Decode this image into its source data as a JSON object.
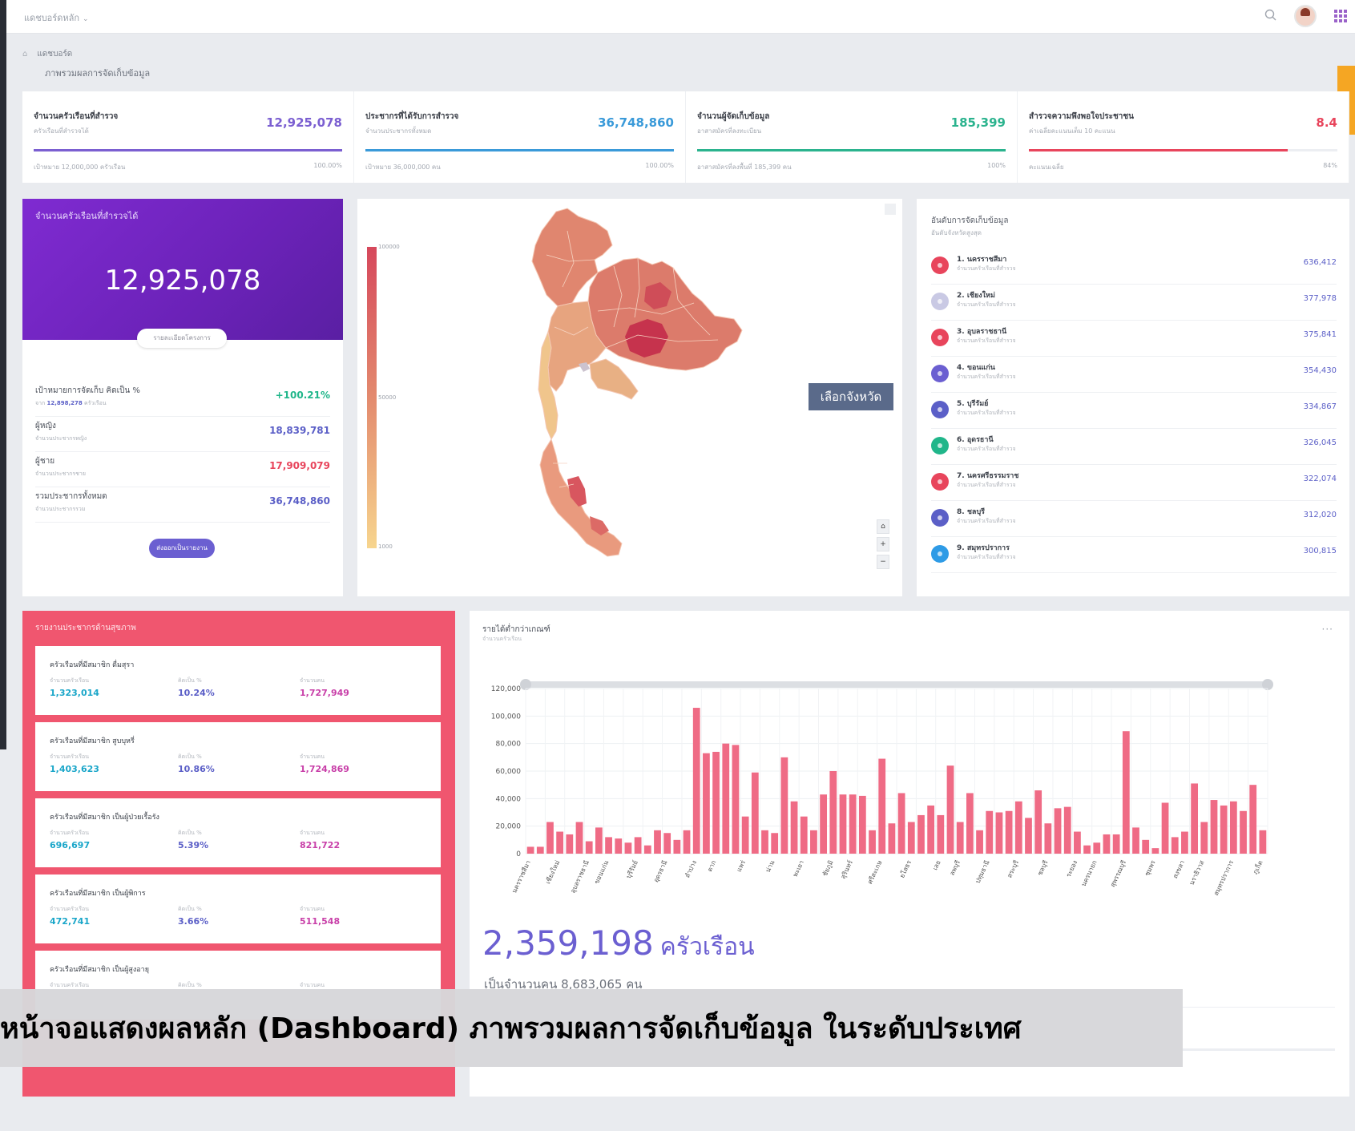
{
  "topbar": {
    "brand": "แดชบอร์ดหลัก"
  },
  "breadcrumb": {
    "label": "แดชบอร์ด"
  },
  "page_title": "ภาพรวมผลการจัดเก็บข้อมูล",
  "kpis": [
    {
      "title": "จำนวนครัวเรือนที่สำรวจ",
      "sub": "ครัวเรือนที่สำรวจได้",
      "value": "12,925,078",
      "progress": 1.0,
      "foot_left": "เป้าหมาย 12,000,000 ครัวเรือน",
      "foot_right": "100.00%",
      "color": "#7b5fd1"
    },
    {
      "title": "ประชากรที่ได้รับการสำรวจ",
      "sub": "จำนวนประชากรทั้งหมด",
      "value": "36,748,860",
      "progress": 1.0,
      "foot_left": "เป้าหมาย 36,000,000 คน",
      "foot_right": "100.00%",
      "color": "#3a9ad9"
    },
    {
      "title": "จำนวนผู้จัดเก็บข้อมูล",
      "sub": "อาสาสมัครที่ลงทะเบียน",
      "value": "185,399",
      "progress": 1.0,
      "foot_left": "อาสาสมัครที่ลงพื้นที่ 185,399 คน",
      "foot_right": "100%",
      "color": "#2bb38e"
    },
    {
      "title": "สำรวจความพึงพอใจประชาชน",
      "sub": "ค่าเฉลี่ยคะแนนเต็ม 10 คะแนน",
      "value": "8.4",
      "progress": 0.84,
      "foot_left": "คะแนนเฉลี่ย",
      "foot_right": "84%",
      "color": "#e8455c"
    }
  ],
  "household_card": {
    "label": "จำนวนครัวเรือนที่สำรวจได้",
    "total": "12,925,078",
    "detail_button": "รายละเอียดโครงการ",
    "stats": [
      {
        "name": "เป้าหมายการจัดเก็บ คิดเป็น %",
        "sub_prefix": "จาก",
        "sub_value": "12,898,278",
        "sub_suffix": "ครัวเรือน",
        "value": "+100.21%",
        "color": "#20b68a"
      },
      {
        "name": "ผู้หญิง",
        "sub_prefix": "จำนวนประชากรหญิง",
        "value": "18,839,781",
        "color": "#5b5fc7"
      },
      {
        "name": "ผู้ชาย",
        "sub_prefix": "จำนวนประชากรชาย",
        "value": "17,909,079",
        "color": "#e8455c"
      },
      {
        "name": "รวมประชากรทั้งหมด",
        "sub_prefix": "จำนวนประชากรรวม",
        "value": "36,748,860",
        "color": "#5b5fc7"
      }
    ],
    "admin_button": "ส่งออกเป็นรายงาน"
  },
  "map": {
    "legend_high": "100000",
    "legend_mid": "50000",
    "legend_low": "1000",
    "province_button": "เลือกจังหวัด",
    "zoom_home": "⌂",
    "zoom_in": "+",
    "zoom_out": "−"
  },
  "ranking": {
    "title": "อันดับการจัดเก็บข้อมูล",
    "subtitle": "อันดับจังหวัดสูงสุด",
    "items": [
      {
        "name": "1. นครราชสีมา",
        "sub": "จำนวนครัวเรือนที่สำรวจ",
        "value": "636,412",
        "color": "#e8455c"
      },
      {
        "name": "2. เชียงใหม่",
        "sub": "จำนวนครัวเรือนที่สำรวจ",
        "value": "377,978",
        "color": "#c9c9e4"
      },
      {
        "name": "3. อุบลราชธานี",
        "sub": "จำนวนครัวเรือนที่สำรวจ",
        "value": "375,841",
        "color": "#e8455c"
      },
      {
        "name": "4. ขอนแก่น",
        "sub": "จำนวนครัวเรือนที่สำรวจ",
        "value": "354,430",
        "color": "#6b5fd1"
      },
      {
        "name": "5. บุรีรัมย์",
        "sub": "จำนวนครัวเรือนที่สำรวจ",
        "value": "334,867",
        "color": "#5b5fc7"
      },
      {
        "name": "6. อุดรธานี",
        "sub": "จำนวนครัวเรือนที่สำรวจ",
        "value": "326,045",
        "color": "#20b68a"
      },
      {
        "name": "7. นครศรีธรรมราช",
        "sub": "จำนวนครัวเรือนที่สำรวจ",
        "value": "322,074",
        "color": "#e8455c"
      },
      {
        "name": "8. ชลบุรี",
        "sub": "จำนวนครัวเรือนที่สำรวจ",
        "value": "312,020",
        "color": "#5b5fc7"
      },
      {
        "name": "9. สมุทรปราการ",
        "sub": "จำนวนครัวเรือนที่สำรวจ",
        "value": "300,815",
        "color": "#2e9be6"
      }
    ]
  },
  "health": {
    "title": "รายงานประชากรด้านสุขภาพ",
    "col1_label": "จำนวนครัวเรือน",
    "col2_label": "คิดเป็น %",
    "col3_label": "จำนวนคน",
    "items": [
      {
        "title": "ครัวเรือนที่มีสมาชิก ดื่มสุรา",
        "households": "1,323,014",
        "percent": "10.24%",
        "people": "1,727,949"
      },
      {
        "title": "ครัวเรือนที่มีสมาชิก สูบบุหรี่",
        "households": "1,403,623",
        "percent": "10.86%",
        "people": "1,724,869"
      },
      {
        "title": "ครัวเรือนที่มีสมาชิก เป็นผู้ป่วยเรื้อรัง",
        "households": "696,697",
        "percent": "5.39%",
        "people": "821,722"
      },
      {
        "title": "ครัวเรือนที่มีสมาชิก เป็นผู้พิการ",
        "households": "472,741",
        "percent": "3.66%",
        "people": "511,548"
      },
      {
        "title": "ครัวเรือนที่มีสมาชิก เป็นผู้สูงอายุ",
        "households": "",
        "percent": "",
        "people": ""
      }
    ]
  },
  "chart_card": {
    "title": "รายได้ต่ำกว่าเกณฑ์",
    "subtitle": "จำนวนครัวเรือน",
    "menu": "···",
    "total_value": "2,359,198",
    "total_unit": "ครัวเรือน",
    "people_text": "เป็นจำนวนคน 8,683,065 คน"
  },
  "chart_data": {
    "type": "bar",
    "ylim": [
      0,
      120000
    ],
    "yticks": [
      0,
      20000,
      40000,
      60000,
      80000,
      100000,
      120000
    ],
    "ytick_labels": [
      "0",
      "20,000",
      "40,000",
      "60,000",
      "80,000",
      "100,000",
      "120,000"
    ],
    "grid": true,
    "color": "#ef6b85",
    "values": [
      5000,
      5000,
      23000,
      16000,
      14000,
      23000,
      9000,
      19000,
      12000,
      11000,
      8000,
      12000,
      6000,
      17000,
      15000,
      10000,
      17000,
      106000,
      73000,
      74000,
      80000,
      79000,
      27000,
      59000,
      17000,
      15000,
      70000,
      38000,
      27000,
      17000,
      43000,
      60000,
      43000,
      43000,
      42000,
      17000,
      69000,
      22000,
      44000,
      23000,
      28000,
      35000,
      28000,
      64000,
      23000,
      44000,
      17000,
      31000,
      30000,
      31000,
      38000,
      26000,
      46000,
      22000,
      33000,
      34000,
      16000,
      6000,
      8000,
      14000,
      14000,
      89000,
      19000,
      10000,
      4000,
      37000,
      12000,
      16000,
      51000,
      23000,
      39000,
      35000,
      38000,
      31000,
      50000,
      17000
    ],
    "category_labels": [
      "นครราชสีมา",
      "เชียงใหม่",
      "อุบลราชธานี",
      "ขอนแก่น",
      "บุรีรัมย์",
      "อุดรธานี",
      "ลำปาง",
      "ตาก",
      "แพร่",
      "น่าน",
      "พะเยา",
      "ชัยภูมิ",
      "สุรินทร์",
      "ศรีสะเกษ",
      "ยโสธร",
      "เลย",
      "ลพบุรี",
      "ปทุมธานี",
      "สระบุรี",
      "ชลบุรี",
      "ระยอง",
      "นครนายก",
      "สุพรรณบุรี",
      "ชุมพร",
      "สงขลา",
      "นราธิวาส",
      "สมุทรปราการ",
      "ภูเก็ต"
    ]
  },
  "caption": "หน้าจอแสดงผลหลัก (Dashboard) ภาพรวมผลการจัดเก็บข้อมูล ในระดับประเทศ"
}
